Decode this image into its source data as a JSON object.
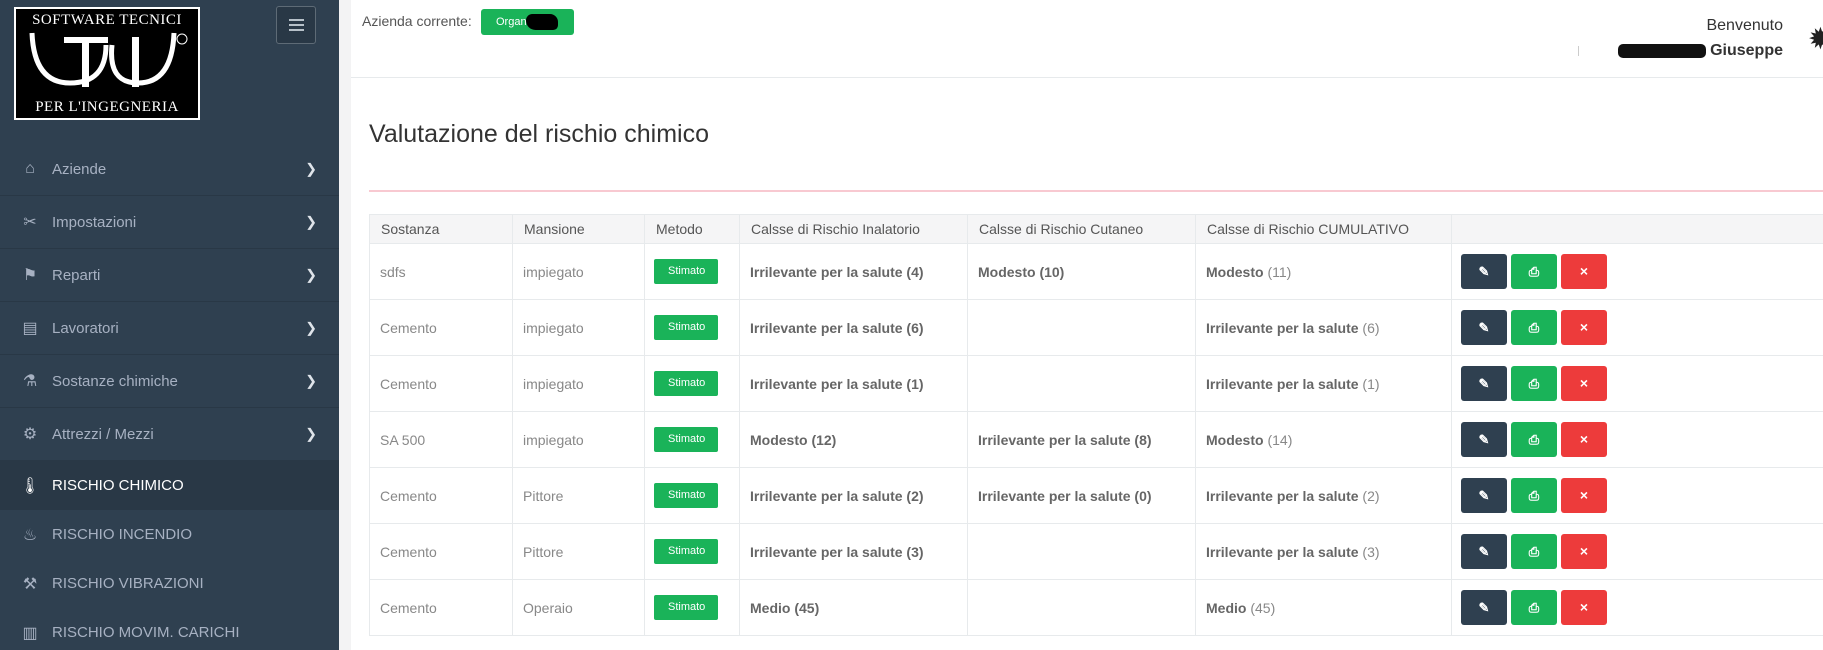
{
  "logo": {
    "top_text": "SOFTWARE TECNICI",
    "bottom_text": "PER L'INGEGNERIA",
    "mark": "TSI",
    "registered": "®"
  },
  "sidebar": {
    "items": [
      {
        "label": "Aziende",
        "icon": "home-icon",
        "glyph": "⌂",
        "has_chevron": true
      },
      {
        "label": "Impostazioni",
        "icon": "tools-icon",
        "glyph": "✂",
        "has_chevron": true
      },
      {
        "label": "Reparti",
        "icon": "signpost-icon",
        "glyph": "⚑",
        "has_chevron": true
      },
      {
        "label": "Lavoratori",
        "icon": "id-card-icon",
        "glyph": "▤",
        "has_chevron": true
      },
      {
        "label": "Sostanze chimiche",
        "icon": "flask-icon",
        "glyph": "⚗",
        "has_chevron": true
      },
      {
        "label": "Attrezzi / Mezzi",
        "icon": "wheel-icon",
        "glyph": "⚙",
        "has_chevron": true
      },
      {
        "label": "RISCHIO CHIMICO",
        "icon": "thermometer-icon",
        "glyph": "🌡",
        "has_chevron": false,
        "active": true
      },
      {
        "label": "RISCHIO INCENDIO",
        "icon": "fire-icon",
        "glyph": "♨",
        "has_chevron": false
      },
      {
        "label": "RISCHIO VIBRAZIONI",
        "icon": "jackhammer-icon",
        "glyph": "⚒",
        "has_chevron": false
      },
      {
        "label": "RISCHIO MOVIM. CARICHI",
        "icon": "luggage-icon",
        "glyph": "▥",
        "has_chevron": false
      }
    ]
  },
  "topbar": {
    "azienda_label": "Azienda corrente:",
    "azienda_badge": "Organi",
    "welcome": "Benvenuto",
    "user_name": "Giuseppe"
  },
  "page": {
    "title": "Valutazione del rischio chimico"
  },
  "table": {
    "headers": [
      "Sostanza",
      "Mansione",
      "Metodo",
      "Calsse di Rischio Inalatorio",
      "Calsse di Rischio Cutaneo",
      "Calsse di Rischio CUMULATIVO",
      ""
    ],
    "rows": [
      {
        "sostanza": "sdfs",
        "mansione": "impiegato",
        "metodo": "Stimato",
        "inalatorio": "Irrilevante per la salute (4)",
        "cutaneo": "Modesto (10)",
        "cum_label": "Modesto",
        "cum_value": "(11)"
      },
      {
        "sostanza": "Cemento",
        "mansione": "impiegato",
        "metodo": "Stimato",
        "inalatorio": "Irrilevante per la salute (6)",
        "cutaneo": "",
        "cum_label": "Irrilevante per la salute",
        "cum_value": "(6)"
      },
      {
        "sostanza": "Cemento",
        "mansione": "impiegato",
        "metodo": "Stimato",
        "inalatorio": "Irrilevante per la salute (1)",
        "cutaneo": "",
        "cum_label": "Irrilevante per la salute",
        "cum_value": "(1)"
      },
      {
        "sostanza": "SA 500",
        "mansione": "impiegato",
        "metodo": "Stimato",
        "inalatorio": "Modesto (12)",
        "cutaneo": "Irrilevante per la salute (8)",
        "cum_label": "Modesto",
        "cum_value": "(14)"
      },
      {
        "sostanza": "Cemento",
        "mansione": "Pittore",
        "metodo": "Stimato",
        "inalatorio": "Irrilevante per la salute (2)",
        "cutaneo": "Irrilevante per la salute (0)",
        "cum_label": "Irrilevante per la salute",
        "cum_value": "(2)"
      },
      {
        "sostanza": "Cemento",
        "mansione": "Pittore",
        "metodo": "Stimato",
        "inalatorio": "Irrilevante per la salute (3)",
        "cutaneo": "",
        "cum_label": "Irrilevante per la salute",
        "cum_value": "(3)"
      },
      {
        "sostanza": "Cemento",
        "mansione": "Operaio",
        "metodo": "Stimato",
        "inalatorio": "Medio (45)",
        "cutaneo": "",
        "cum_label": "Medio",
        "cum_value": "(45)"
      }
    ],
    "action_icons": {
      "edit": "✎",
      "print": "⎙",
      "delete": "×"
    }
  },
  "colors": {
    "sidebar": "#2f4050",
    "green": "#1ab359",
    "red": "#ed3b3b",
    "accent_line": "#f8c9d1"
  }
}
